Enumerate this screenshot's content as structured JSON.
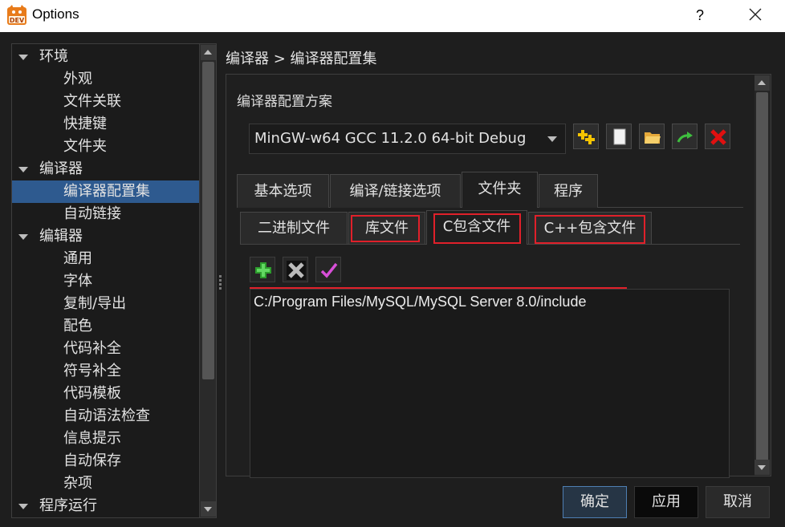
{
  "window": {
    "title": "Options",
    "help_label": "?"
  },
  "tree": {
    "items": [
      {
        "label": "环境",
        "level": 0,
        "expanded": true
      },
      {
        "label": "外观",
        "level": 1
      },
      {
        "label": "文件关联",
        "level": 1
      },
      {
        "label": "快捷键",
        "level": 1
      },
      {
        "label": "文件夹",
        "level": 1
      },
      {
        "label": "编译器",
        "level": 0,
        "expanded": true
      },
      {
        "label": "编译器配置集",
        "level": 1,
        "selected": true
      },
      {
        "label": "自动链接",
        "level": 1
      },
      {
        "label": "编辑器",
        "level": 0,
        "expanded": true
      },
      {
        "label": "通用",
        "level": 1
      },
      {
        "label": "字体",
        "level": 1
      },
      {
        "label": "复制/导出",
        "level": 1
      },
      {
        "label": "配色",
        "level": 1
      },
      {
        "label": "代码补全",
        "level": 1
      },
      {
        "label": "符号补全",
        "level": 1
      },
      {
        "label": "代码模板",
        "level": 1
      },
      {
        "label": "自动语法检查",
        "level": 1
      },
      {
        "label": "信息提示",
        "level": 1
      },
      {
        "label": "自动保存",
        "level": 1
      },
      {
        "label": "杂项",
        "level": 1
      },
      {
        "label": "程序运行",
        "level": 0,
        "expanded": true
      }
    ]
  },
  "breadcrumb": "编译器 > 编译器配置集",
  "compiler_set": {
    "section_label": "编译器配置方案",
    "selected_profile": "MinGW-w64 GCC 11.2.0 64-bit Debug",
    "toolbar_icons": [
      "add-profile-icon",
      "copy-profile-icon",
      "open-folder-icon",
      "rename-arrow-icon",
      "delete-x-icon"
    ]
  },
  "tabs": [
    {
      "label": "基本选项",
      "active": false
    },
    {
      "label": "编译/链接选项",
      "active": false
    },
    {
      "label": "文件夹",
      "active": true
    },
    {
      "label": "程序",
      "active": false
    }
  ],
  "subtabs": [
    {
      "label": "二进制文件",
      "active": false,
      "highlighted": false
    },
    {
      "label": "库文件",
      "active": false,
      "highlighted": true
    },
    {
      "label": "C包含文件",
      "active": true,
      "highlighted": true
    },
    {
      "label": "C++包含文件",
      "active": false,
      "highlighted": true
    }
  ],
  "dir_toolbar_icons": [
    "add-plus-icon",
    "remove-x-icon",
    "validate-check-icon"
  ],
  "directories": [
    "C:/Program Files/MySQL/MySQL Server 8.0/include"
  ],
  "colors": {
    "accent": "#2e5a8f",
    "highlight_box": "#e0202a"
  },
  "buttons": {
    "ok": "确定",
    "apply": "应用",
    "cancel": "取消"
  }
}
